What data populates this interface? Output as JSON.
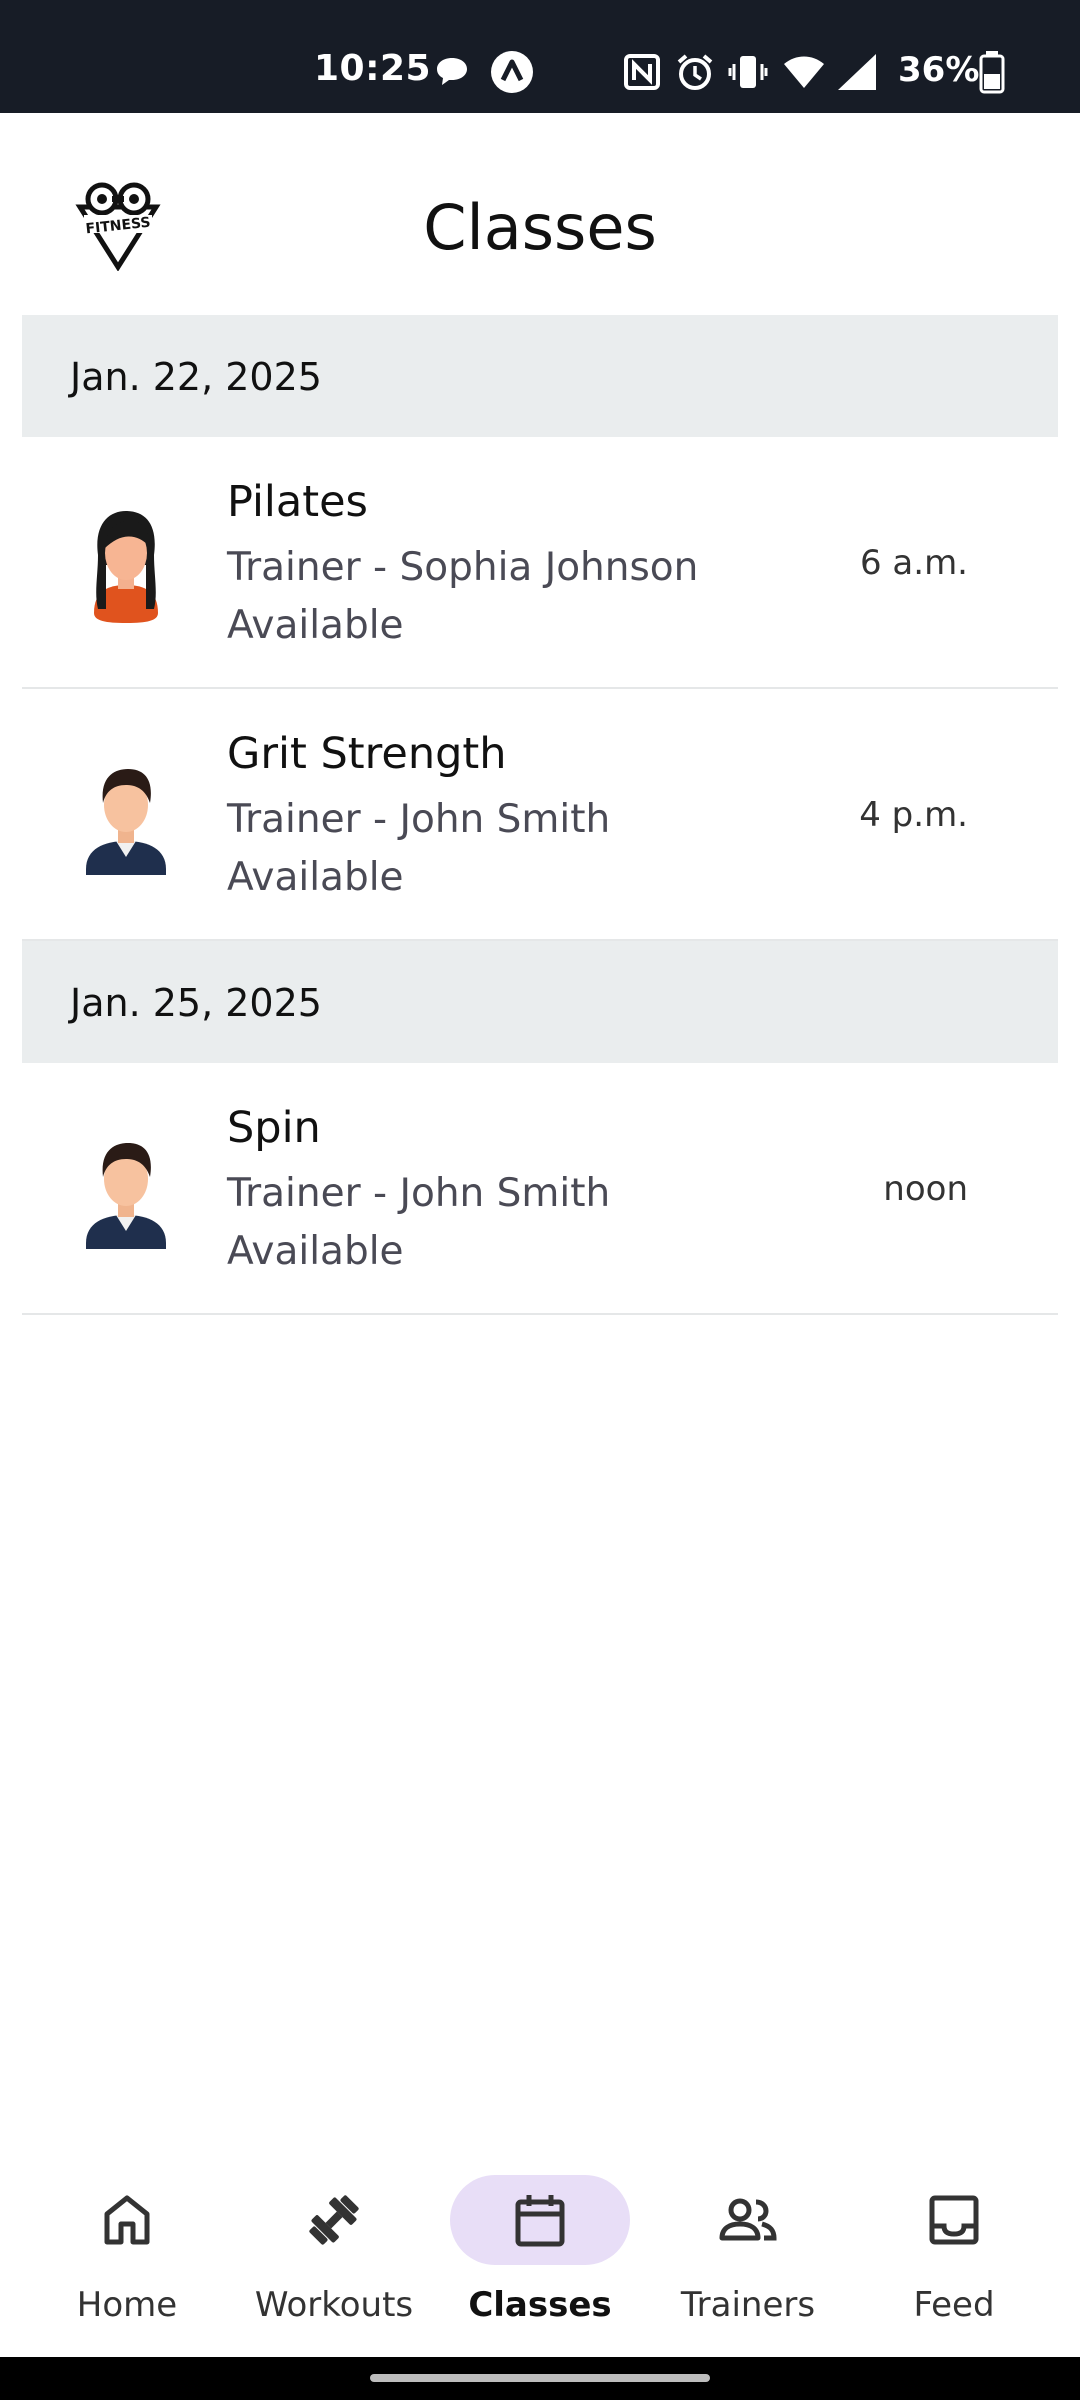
{
  "status_bar": {
    "time": "10:25",
    "battery_percent": "36%",
    "icons": [
      "message-bubble-icon",
      "app-a-icon",
      "nfc-icon",
      "alarm-icon",
      "vibrate-icon",
      "wifi-icon",
      "signal-icon",
      "battery-icon"
    ]
  },
  "header": {
    "title": "Classes",
    "logo_icon": "fitness-logo-icon"
  },
  "sections": [
    {
      "date": "Jan. 22, 2025",
      "classes": [
        {
          "name": "Pilates",
          "trainer": "Trainer - Sophia Johnson",
          "availability": "Available",
          "time": "6 a.m.",
          "avatar": "female-avatar"
        },
        {
          "name": "Grit Strength",
          "trainer": "Trainer - John Smith",
          "availability": "Available",
          "time": "4 p.m.",
          "avatar": "male-avatar"
        }
      ]
    },
    {
      "date": "Jan. 25, 2025",
      "classes": [
        {
          "name": "Spin",
          "trainer": "Trainer - John Smith",
          "availability": "Available",
          "time": "noon",
          "avatar": "male-avatar"
        }
      ]
    }
  ],
  "bottom_nav": {
    "active": "Classes",
    "items": [
      {
        "label": "Home",
        "icon": "home-icon"
      },
      {
        "label": "Workouts",
        "icon": "dumbbell-icon"
      },
      {
        "label": "Classes",
        "icon": "calendar-icon"
      },
      {
        "label": "Trainers",
        "icon": "people-icon"
      },
      {
        "label": "Feed",
        "icon": "inbox-icon"
      }
    ]
  },
  "colors": {
    "status_bar_bg": "#171c26",
    "section_bg": "#eaedee",
    "active_pill": "#e8def7"
  }
}
